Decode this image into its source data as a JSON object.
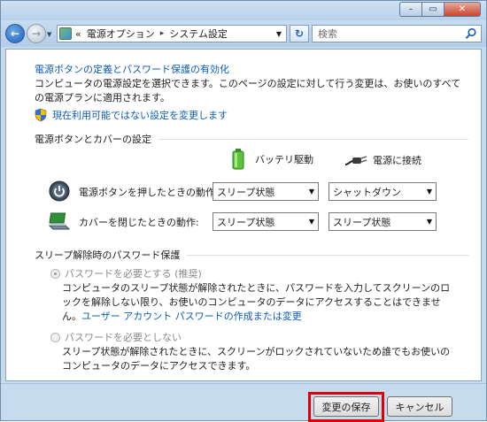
{
  "window": {
    "caption_buttons": {
      "minimize": "–",
      "maximize": "▭",
      "close": "✕"
    }
  },
  "nav": {
    "back_glyph": "←",
    "forward_glyph": "→",
    "address": {
      "prefix": "«",
      "crumbs": [
        "電源オプション",
        "システム設定"
      ],
      "separator": "▸"
    },
    "refresh_glyph": "↻",
    "search_placeholder": "検索"
  },
  "page": {
    "heading": "電源ボタンの定義とパスワード保護の有効化",
    "description": "コンピュータの電源設定を選択できます。このページの設定に対して行う変更は、お使いのすべての電源プランに適用されます。",
    "change_unavailable_link": "現在利用可能ではない設定を変更します"
  },
  "power_buttons": {
    "group_title": "電源ボタンとカバーの設定",
    "col_battery": "バッテリ駆動",
    "col_plugged": "電源に接続",
    "rows": [
      {
        "label": "電源ボタンを押したときの動作:",
        "battery": "スリープ状態",
        "plugged": "シャットダウン"
      },
      {
        "label": "カバーを閉じたときの動作:",
        "battery": "スリープ状態",
        "plugged": "スリープ状態"
      }
    ]
  },
  "password": {
    "group_title": "スリープ解除時のパスワード保護",
    "require": {
      "label": "パスワードを必要とする (推奨)",
      "desc_before_link": "コンピュータのスリープ状態が解除されたときに、パスワードを入力してスクリーンのロックを解除しない限り、お使いのコンピュータのデータにアクセスすることはできません。",
      "link": "ユーザー アカウント パスワードの作成または変更"
    },
    "not_require": {
      "label": "パスワードを必要としない",
      "desc": "スリープ状態が解除されたときに、スクリーンがロックされていないため誰でもお使いのコンピュータのデータにアクセスできます。"
    }
  },
  "footer": {
    "save": "変更の保存",
    "cancel": "キャンセル"
  },
  "colors": {
    "link": "#0e5cba",
    "highlight": "#e00000",
    "window_frame": "#c6dbee"
  }
}
